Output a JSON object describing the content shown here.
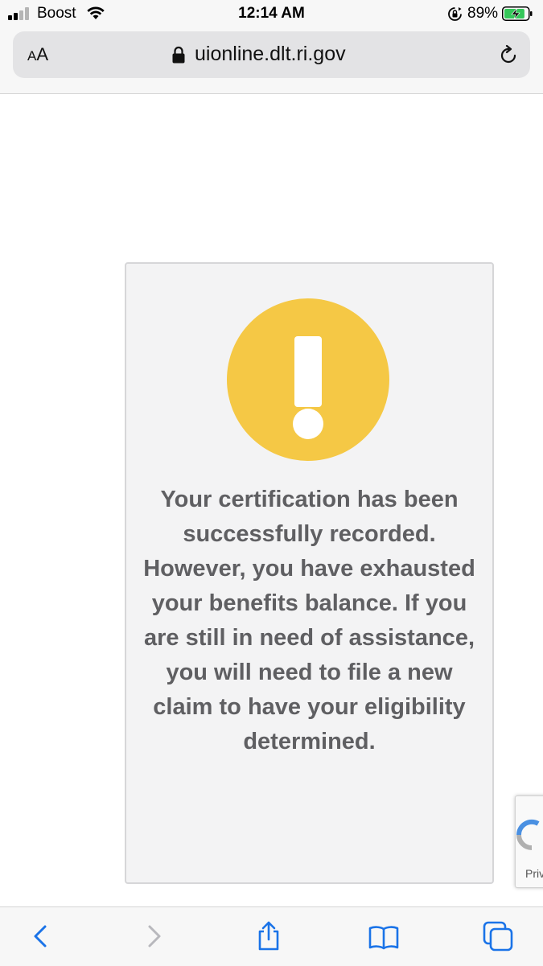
{
  "status_bar": {
    "carrier": "Boost",
    "time": "12:14 AM",
    "battery_percent": "89%",
    "battery_level": 0.89,
    "signal_bars": 2
  },
  "browser": {
    "aa_small": "A",
    "aa_large": "A",
    "url": "uionline.dlt.ri.gov"
  },
  "alert": {
    "icon": "exclamation-warning-icon",
    "accent_color": "#f5c845",
    "message": "Your certification has been successfully recorded. However, you have exhausted your benefits balance. If you are still in need of assistance, you will need to file a new claim to have your eligibility determined."
  },
  "recaptcha": {
    "label": "Privacy - Terms"
  },
  "toolbar": {
    "icons": [
      "back-icon",
      "forward-icon",
      "share-icon",
      "bookmarks-icon",
      "tabs-icon"
    ],
    "accent_color": "#1a73e8"
  }
}
